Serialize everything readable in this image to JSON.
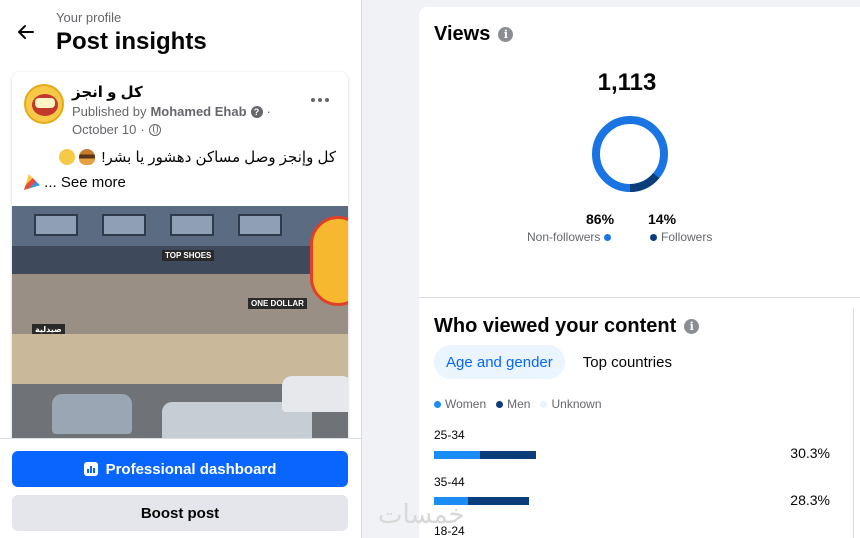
{
  "header": {
    "breadcrumb": "Your profile",
    "title": "Post insights"
  },
  "post": {
    "page_name": "كل و انجز",
    "published_by_prefix": "Published by",
    "author": "Mohamed Ehab",
    "date": "October 10",
    "caption": "كل وإنجز وصل مساكن دهشور يا بشر!",
    "see_more": "... See more",
    "image_signs": [
      "TOP SHOES",
      "ONE DOLLAR",
      "صيدلية"
    ]
  },
  "actions": {
    "professional_dashboard": "Professional dashboard",
    "boost_post": "Boost post"
  },
  "views": {
    "title": "Views",
    "total": "1,113",
    "non_followers_pct": "86%",
    "non_followers_label": "Non-followers",
    "followers_pct": "14%",
    "followers_label": "Followers",
    "non_followers_color": "#1b74e4",
    "followers_color": "#0a3d7a"
  },
  "audience": {
    "title": "Who viewed your content",
    "tabs": [
      "Age and gender",
      "Top countries"
    ],
    "active_tab": "Age and gender",
    "legend": [
      "Women",
      "Men",
      "Unknown"
    ],
    "colors": {
      "women": "#1b8cf5",
      "men": "#0a3d7a",
      "unknown": "#e7f3ff"
    },
    "rows": [
      {
        "age": "25-34",
        "pct": "30.3%",
        "women_share": 0.45,
        "total": 30.3
      },
      {
        "age": "35-44",
        "pct": "28.3%",
        "women_share": 0.36,
        "total": 28.3
      },
      {
        "age": "18-24",
        "pct": "",
        "women_share": 0,
        "total": 0
      }
    ]
  },
  "watermark": "خمسات"
}
